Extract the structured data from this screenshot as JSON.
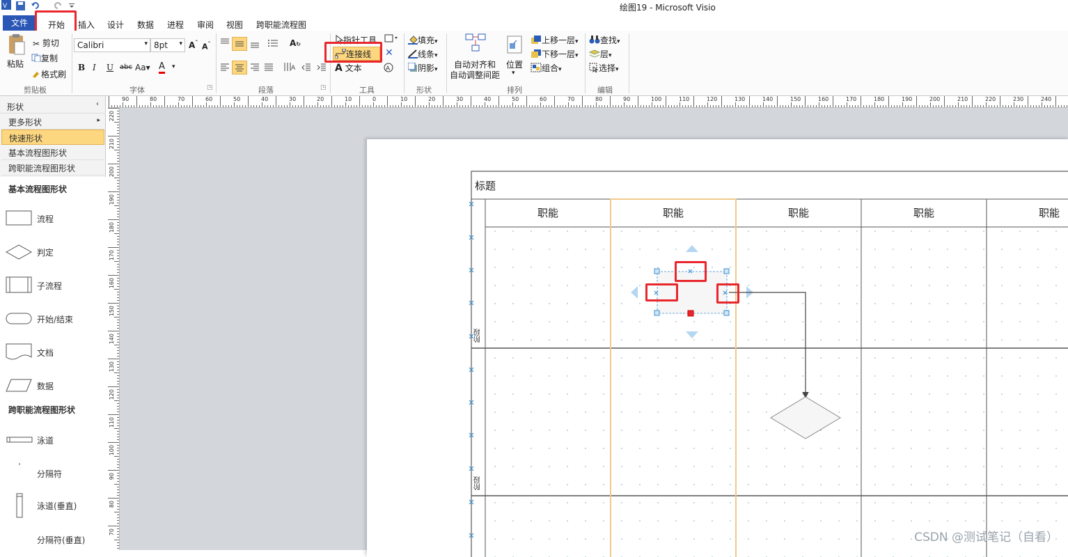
{
  "window": {
    "title": "绘图19 - Microsoft Visio"
  },
  "menu": {
    "file": "文件",
    "tabs": [
      "开始",
      "插入",
      "设计",
      "数据",
      "进程",
      "审阅",
      "视图",
      "跨职能流程图"
    ]
  },
  "ribbon": {
    "clipboard": {
      "paste": "粘贴",
      "cut": "剪切",
      "copy": "复制",
      "format_painter": "格式刷",
      "label": "剪贴板"
    },
    "font": {
      "family": "Calibri",
      "size": "8pt",
      "label": "字体"
    },
    "paragraph": {
      "label": "段落"
    },
    "tools": {
      "pointer": "指针工具",
      "connector": "连接线",
      "text": "文本",
      "label": "工具"
    },
    "shape": {
      "fill": "填充",
      "line": "线条",
      "shadow": "阴影",
      "label": "形状"
    },
    "arrange": {
      "auto_align": "自动对齐和",
      "auto_space": "自动调整间距",
      "position": "位置",
      "bring_forward": "上移一层",
      "send_backward": "下移一层",
      "group": "组合",
      "label": "排列"
    },
    "edit": {
      "find": "查找",
      "layers": "层",
      "select": "选择",
      "label": "编辑"
    }
  },
  "panel": {
    "title": "形状",
    "items": [
      "更多形状",
      "快速形状",
      "基本流程图形状",
      "跨职能流程图形状"
    ],
    "section1": "基本流程图形状",
    "shapes1": [
      "流程",
      "判定",
      "子流程",
      "开始/结束",
      "文档",
      "数据"
    ],
    "section2": "跨职能流程图形状",
    "shapes2": [
      "泳道",
      "分隔符",
      "泳道(垂直)",
      "分隔符(垂直)"
    ]
  },
  "rulers": {
    "top": [
      "90",
      "80",
      "70",
      "60",
      "50",
      "40",
      "30",
      "20",
      "10",
      "0",
      "10",
      "20",
      "30",
      "40",
      "50",
      "60",
      "70",
      "80",
      "90",
      "100",
      "110",
      "120",
      "130",
      "140",
      "150",
      "160",
      "170",
      "180",
      "190",
      "200",
      "210",
      "220",
      "230",
      "240"
    ],
    "left": [
      "220",
      "210",
      "200",
      "190",
      "180",
      "170",
      "160",
      "150",
      "140",
      "130",
      "120",
      "110",
      "100",
      "90",
      "80",
      "70"
    ]
  },
  "diagram": {
    "title": "标题",
    "columns": [
      "职能",
      "职能",
      "职能",
      "职能",
      "职能"
    ],
    "phase": "阶段"
  },
  "watermark": "CSDN @测试笔记（自看）",
  "colors": {
    "file_tab": "#2a56b6",
    "highlight": "#e8262b",
    "selected_panel": "#fcd77f",
    "lane_selected": "#f2c98c"
  }
}
